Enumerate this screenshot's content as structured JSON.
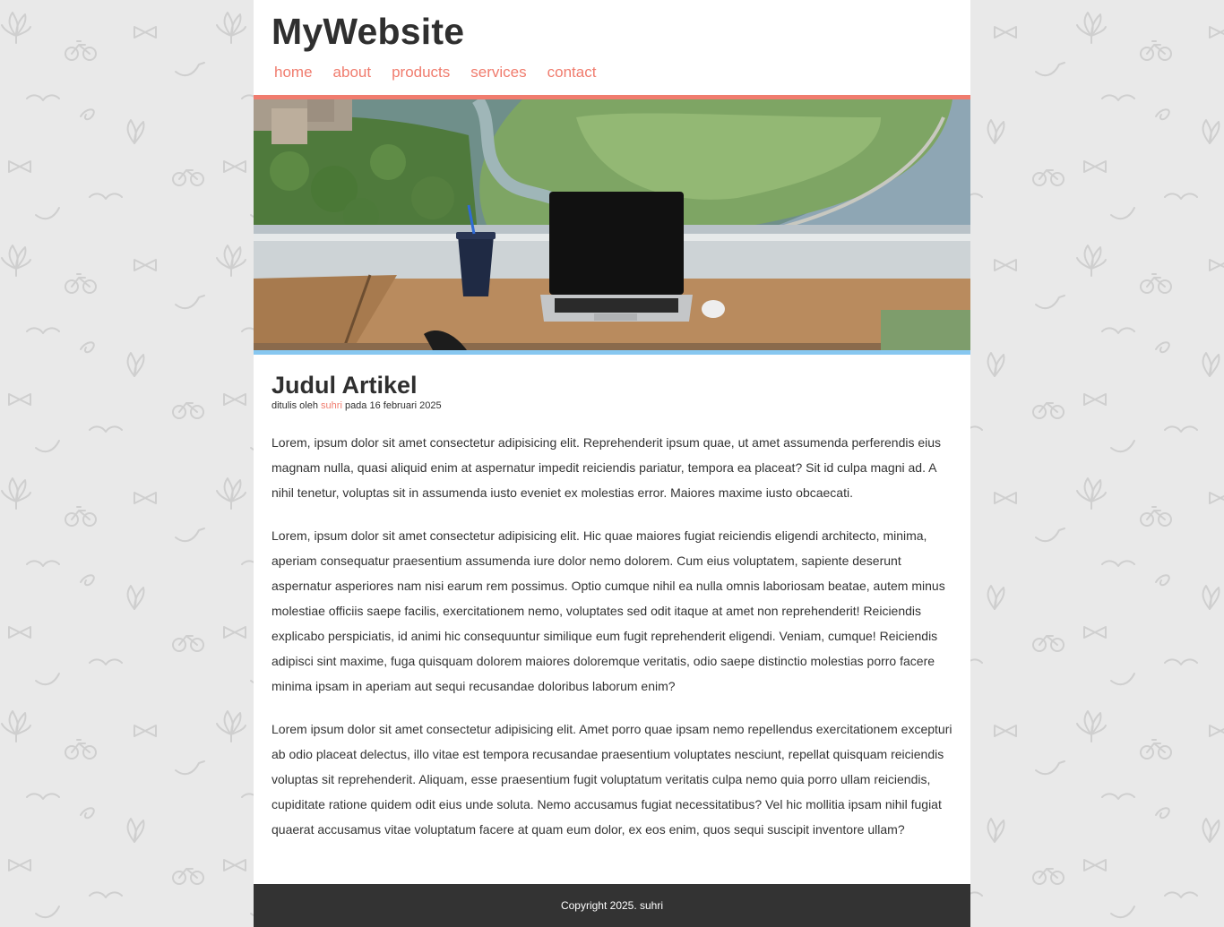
{
  "site": {
    "title": "MyWebsite"
  },
  "nav": {
    "items": [
      {
        "label": "home"
      },
      {
        "label": "about"
      },
      {
        "label": "products"
      },
      {
        "label": "services"
      },
      {
        "label": "contact"
      }
    ]
  },
  "colors": {
    "accent": "#f07c6e",
    "hero_border_bottom": "#87c7f0",
    "footer_bg": "#333333",
    "page_bg": "#e9e9e9"
  },
  "article": {
    "title": "Judul Artikel",
    "meta_prefix": "ditulis oleh ",
    "author": "suhri",
    "meta_suffix": " pada 16 februari 2025",
    "paragraphs": [
      "Lorem, ipsum dolor sit amet consectetur adipisicing elit. Reprehenderit ipsum quae, ut amet assumenda perferendis eius magnam nulla, quasi aliquid enim at aspernatur impedit reiciendis pariatur, tempora ea placeat? Sit id culpa magni ad. A nihil tenetur, voluptas sit in assumenda iusto eveniet ex molestias error. Maiores maxime iusto obcaecati.",
      "Lorem, ipsum dolor sit amet consectetur adipisicing elit. Hic quae maiores fugiat reiciendis eligendi architecto, minima, aperiam consequatur praesentium assumenda iure dolor nemo dolorem. Cum eius voluptatem, sapiente deserunt aspernatur asperiores nam nisi earum rem possimus. Optio cumque nihil ea nulla omnis laboriosam beatae, autem minus molestiae officiis saepe facilis, exercitationem nemo, voluptates sed odit itaque at amet non reprehenderit! Reiciendis explicabo perspiciatis, id animi hic consequuntur similique eum fugit reprehenderit eligendi. Veniam, cumque! Reiciendis adipisci sint maxime, fuga quisquam dolorem maiores doloremque veritatis, odio saepe distinctio molestias porro facere minima ipsam in aperiam aut sequi recusandae doloribus laborum enim?",
      "Lorem ipsum dolor sit amet consectetur adipisicing elit. Amet porro quae ipsam nemo repellendus exercitationem excepturi ab odio placeat delectus, illo vitae est tempora recusandae praesentium voluptates nesciunt, repellat quisquam reiciendis voluptas sit reprehenderit. Aliquam, esse praesentium fugit voluptatum veritatis culpa nemo quia porro ullam reiciendis, cupiditate ratione quidem odit eius unde soluta. Nemo accusamus fugiat necessitatibus? Vel hic mollitia ipsam nihil fugiat quaerat accusamus vitae voluptatum facere at quam eum dolor, ex eos enim, quos sequi suscipit inventore ullam?"
    ]
  },
  "hero": {
    "image_icon": "laptop-desk-city-view-image"
  },
  "footer": {
    "text": "Copyright 2025. suhri"
  }
}
